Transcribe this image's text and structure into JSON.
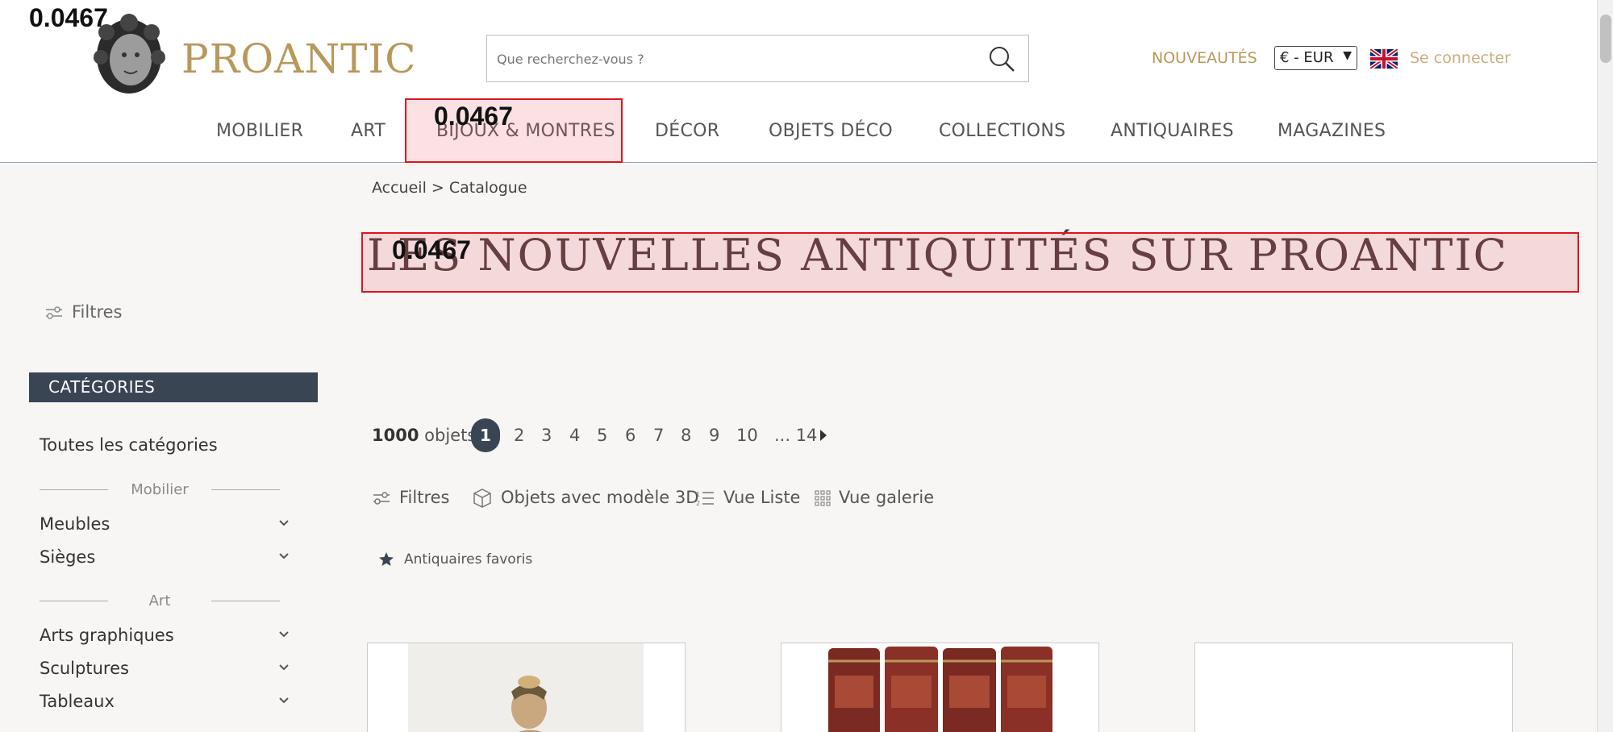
{
  "overlay": {
    "score": "0.0467"
  },
  "header": {
    "brand": "PROANTIC",
    "search_placeholder": "Que recherchez-vous ?",
    "nouveautes": "NOUVEAUTÉS",
    "currency": "€ - EUR",
    "login": "Se connecter"
  },
  "nav": [
    "MOBILIER",
    "ART",
    "BIJOUX & MONTRES",
    "DÉCOR",
    "OBJETS DÉCO",
    "COLLECTIONS",
    "ANTIQUAIRES",
    "MAGAZINES"
  ],
  "breadcrumb": "Accueil > Catalogue",
  "page_title": "LES NOUVELLES ANTIQUITÉS SUR PROANTIC",
  "sidebar": {
    "filter_label": "Filtres",
    "categories_header": "CATÉGORIES",
    "all_categories": "Toutes les catégories",
    "sections": [
      {
        "title": "Mobilier",
        "items": [
          "Meubles",
          "Sièges"
        ]
      },
      {
        "title": "Art",
        "items": [
          "Arts graphiques",
          "Sculptures",
          "Tableaux"
        ]
      }
    ]
  },
  "results": {
    "count": "1000",
    "count_label": "objets",
    "pages": [
      "1",
      "2",
      "3",
      "4",
      "5",
      "6",
      "7",
      "8",
      "9",
      "10",
      "... 14"
    ],
    "current_page": "1"
  },
  "toolbar": {
    "filters": "Filtres",
    "model3d": "Objets avec modèle 3D",
    "list_view": "Vue Liste",
    "gallery_view": "Vue galerie"
  },
  "favorites": "Antiquaires favoris",
  "colors": {
    "gold": "#b8975a",
    "dark_blue": "#3a4554",
    "overlay_red": "#e0141e"
  }
}
